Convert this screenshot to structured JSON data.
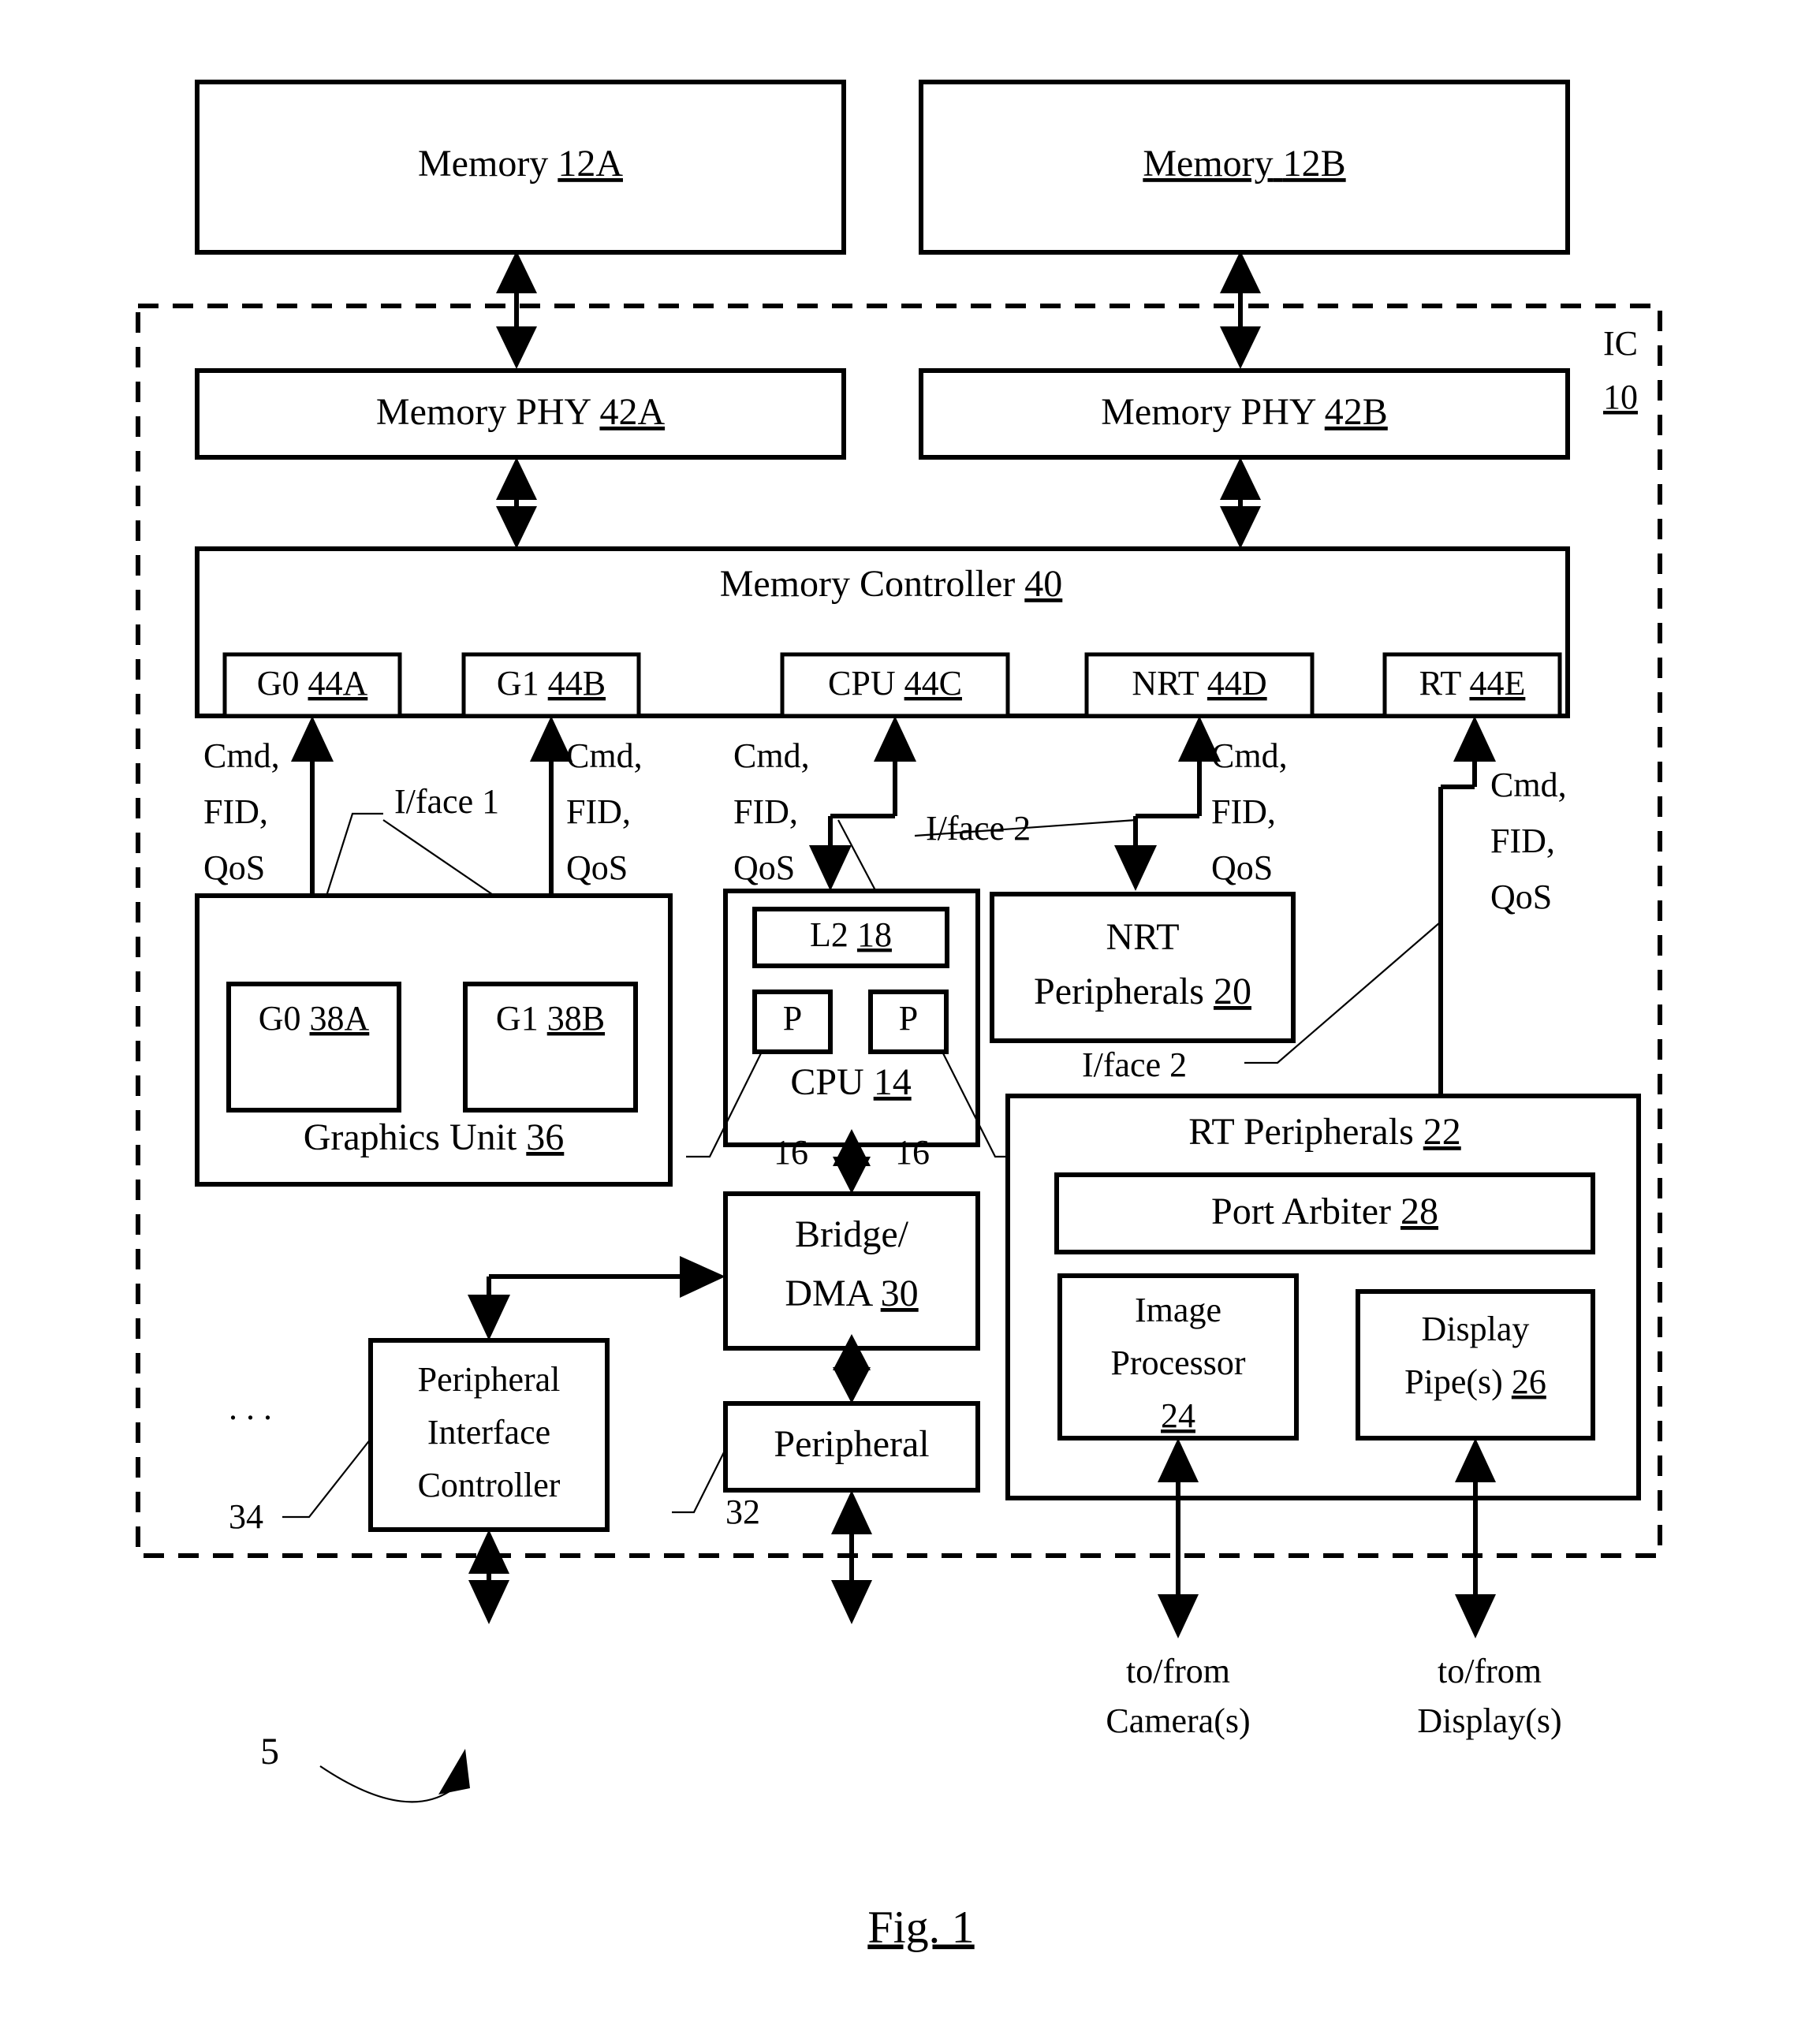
{
  "figure": {
    "caption": "Fig. 1",
    "system_ref": "5",
    "ic_label": "IC",
    "ic_ref": "10"
  },
  "memories": [
    {
      "name": "Memory",
      "ref": "12A",
      "underline": "ref"
    },
    {
      "name": "Memory",
      "ref": "12B",
      "underline": "all"
    }
  ],
  "phys": [
    {
      "name": "Memory PHY",
      "ref": "42A"
    },
    {
      "name": "Memory PHY",
      "ref": "42B"
    }
  ],
  "memory_controller": {
    "name": "Memory Controller",
    "ref": "40",
    "ports": [
      {
        "name": "G0",
        "ref": "44A"
      },
      {
        "name": "G1",
        "ref": "44B"
      },
      {
        "name": "CPU",
        "ref": "44C"
      },
      {
        "name": "NRT",
        "ref": "44D"
      },
      {
        "name": "RT",
        "ref": "44E"
      }
    ]
  },
  "signal_labels": {
    "line1": "Cmd,",
    "line2": "FID,",
    "line3": "QoS"
  },
  "interfaces": {
    "iface1": "I/face 1",
    "iface2": "I/face 2"
  },
  "graphics_unit": {
    "name": "Graphics Unit",
    "ref": "36",
    "engines": [
      {
        "name": "G0",
        "ref": "38A"
      },
      {
        "name": "G1",
        "ref": "38B"
      }
    ]
  },
  "cpu": {
    "name": "CPU",
    "ref": "14",
    "l2": {
      "name": "L2",
      "ref": "18"
    },
    "cores": [
      {
        "name": "P"
      },
      {
        "name": "P"
      }
    ],
    "core_refs": [
      "16",
      "16"
    ]
  },
  "nrt_peripherals": {
    "line1": "NRT",
    "line2": "Peripherals",
    "ref": "20"
  },
  "rt_peripherals": {
    "name": "RT Peripherals",
    "ref": "22",
    "port_arbiter": {
      "name": "Port Arbiter",
      "ref": "28"
    },
    "image_processor": {
      "line1": "Image",
      "line2": "Processor",
      "ref": "24"
    },
    "display_pipes": {
      "line1": "Display",
      "line2": "Pipe(s)",
      "ref": "26"
    }
  },
  "bridge_dma": {
    "line1": "Bridge/",
    "line2": "DMA",
    "ref": "30"
  },
  "peripheral": {
    "name": "Peripheral",
    "ref": "32"
  },
  "peripheral_interface_controller": {
    "line1": "Peripheral",
    "line2": "Interface",
    "line3": "Controller",
    "ref": "34",
    "ellipsis": ". . ."
  },
  "external_io": [
    {
      "line1": "to/from",
      "line2": "Camera(s)"
    },
    {
      "line1": "to/from",
      "line2": "Display(s)"
    }
  ]
}
